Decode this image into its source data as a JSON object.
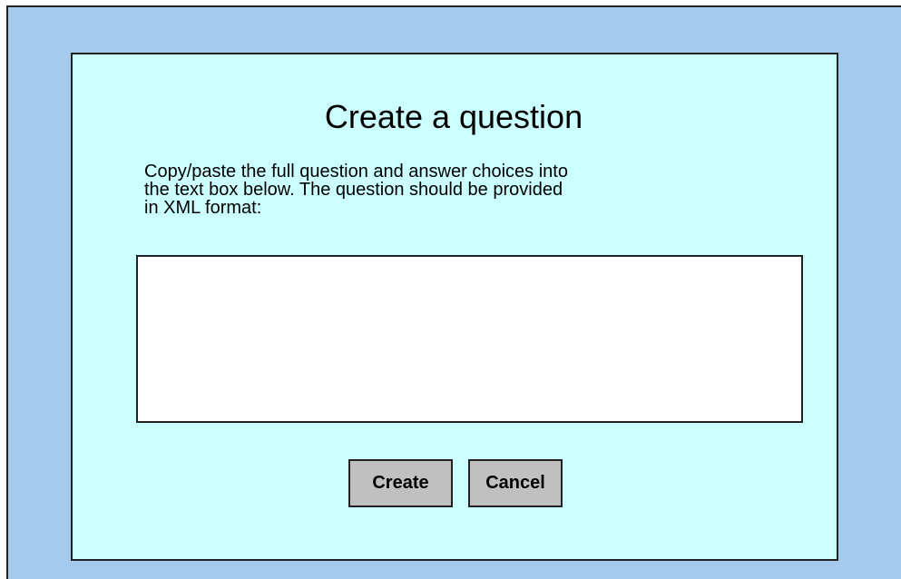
{
  "dialog": {
    "title": "Create a question",
    "instructions_lines": [
      "Copy/paste the full question and answer choices into",
      "the text box below.  The question should be provided",
      "in XML format:"
    ],
    "question_input_value": "",
    "create_label": "Create",
    "cancel_label": "Cancel"
  },
  "colors": {
    "page_background": "#a6caec",
    "dialog_background": "#ccffff",
    "button_background": "#c0c0c0",
    "border": "#222222"
  }
}
